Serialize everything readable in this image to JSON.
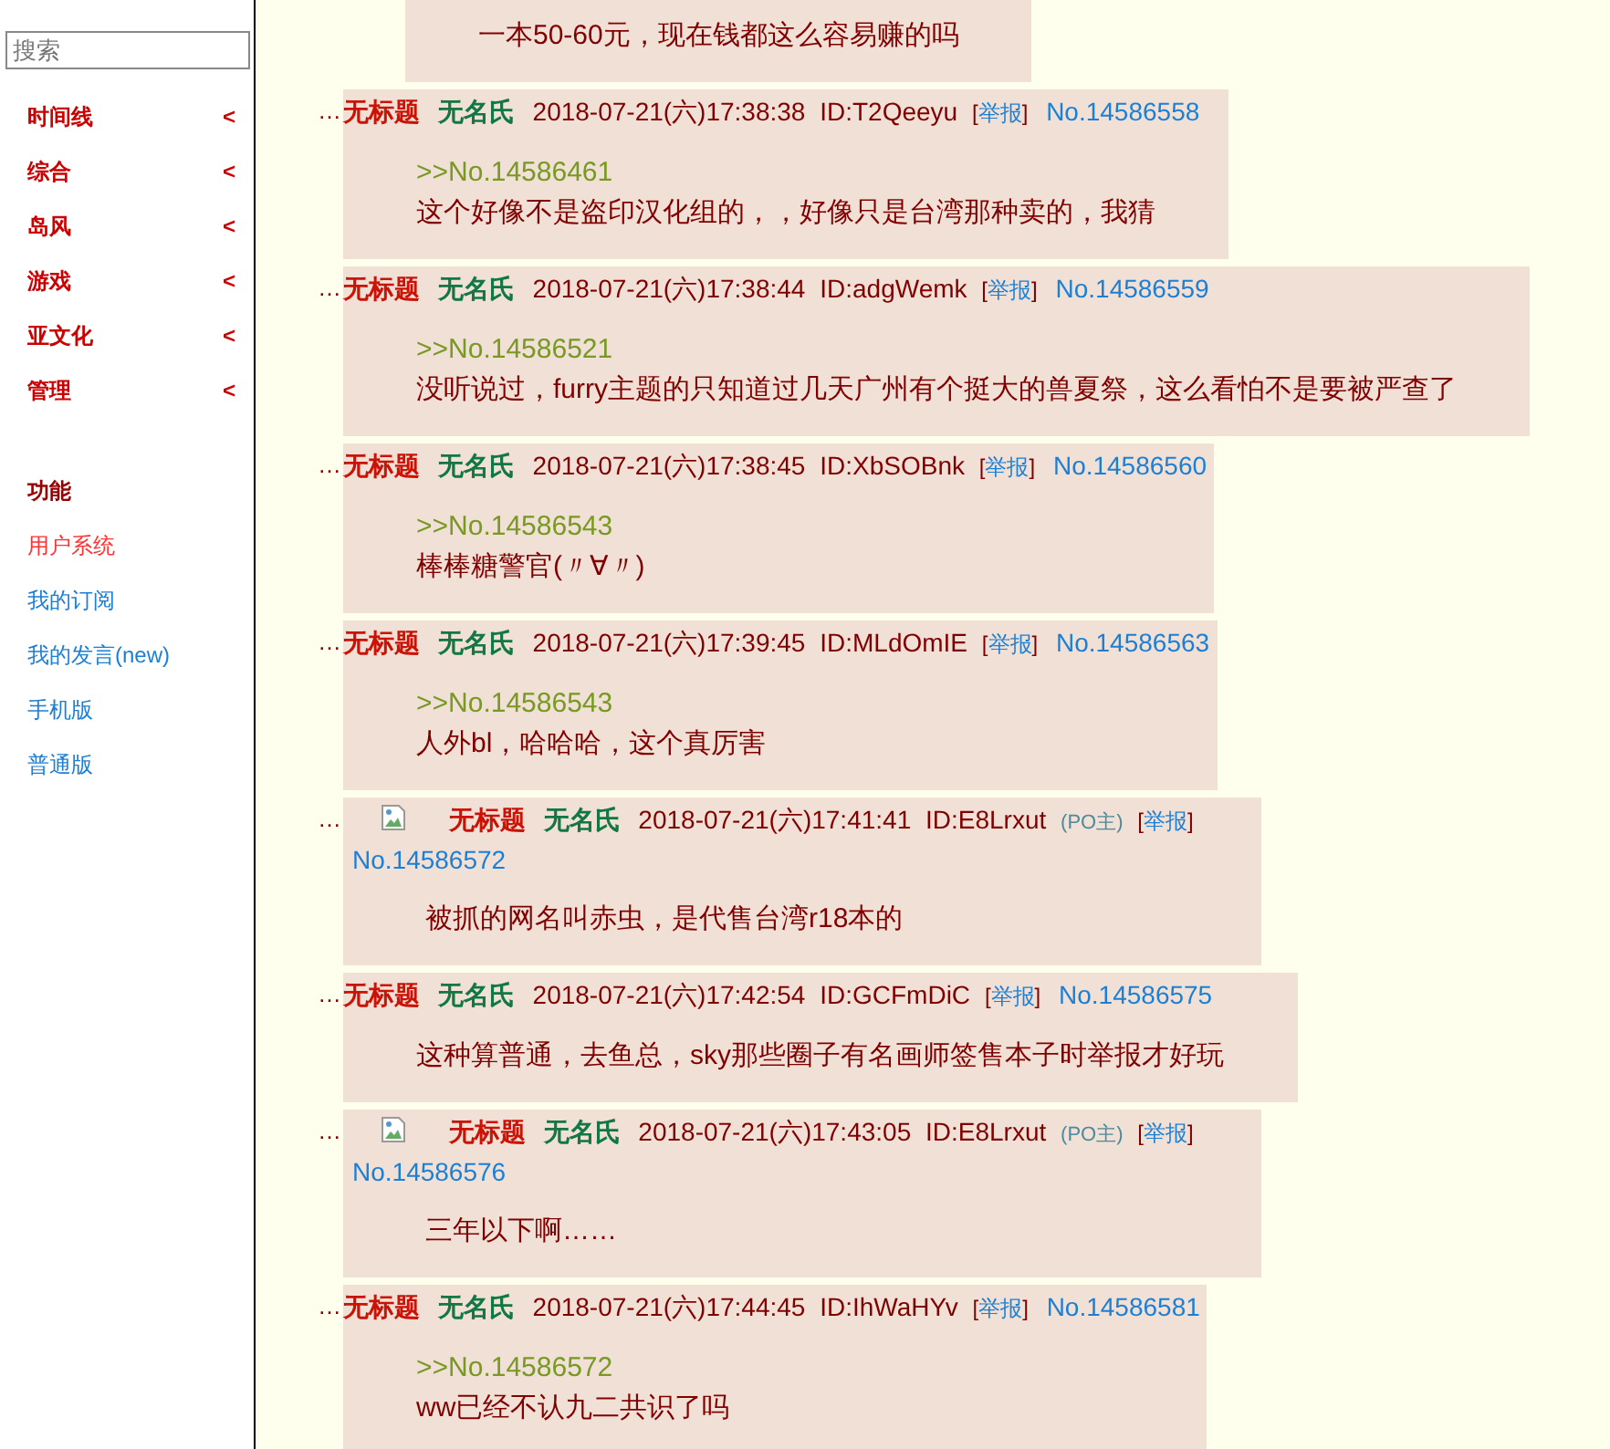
{
  "sidebar": {
    "search": {
      "placeholder": "搜索"
    },
    "nav": [
      {
        "label": "时间线",
        "chevron": "<"
      },
      {
        "label": "综合",
        "chevron": "<"
      },
      {
        "label": "岛风",
        "chevron": "<"
      },
      {
        "label": "游戏",
        "chevron": "<"
      },
      {
        "label": "亚文化",
        "chevron": "<"
      },
      {
        "label": "管理",
        "chevron": "<"
      }
    ],
    "section_title": "功能",
    "links": [
      {
        "label": "用户系统",
        "kind": "highlight"
      },
      {
        "label": "我的订阅",
        "kind": "normal"
      },
      {
        "label": "我的发言(new)",
        "kind": "normal"
      },
      {
        "label": "手机版",
        "kind": "normal"
      },
      {
        "label": "普通版",
        "kind": "normal"
      }
    ]
  },
  "posts": [
    {
      "kind": "fragment",
      "body": "一本50-60元，现在钱都这么容易赚的吗"
    },
    {
      "kind": "text",
      "marker": "…",
      "title": "无标题",
      "name": "无名氏",
      "time": "2018-07-21(六)17:38:38",
      "id": "ID:T2Qeeyu",
      "report": "[举报]",
      "no": "No.14586558",
      "quote": ">>No.14586461",
      "body": "这个好像不是盗印汉化组的，，好像只是台湾那种卖的，我猜"
    },
    {
      "kind": "text",
      "marker": "…",
      "title": "无标题",
      "name": "无名氏",
      "time": "2018-07-21(六)17:38:44",
      "id": "ID:adgWemk",
      "report": "[举报]",
      "no": "No.14586559",
      "quote": ">>No.14586521",
      "body": "没听说过，furry主题的只知道过几天广州有个挺大的兽夏祭，这么看怕不是要被严查了"
    },
    {
      "kind": "text",
      "marker": "…",
      "title": "无标题",
      "name": "无名氏",
      "time": "2018-07-21(六)17:38:45",
      "id": "ID:XbSOBnk",
      "report": "[举报]",
      "no": "No.14586560",
      "quote": ">>No.14586543",
      "body": "棒棒糖警官(〃∀〃)"
    },
    {
      "kind": "text",
      "marker": "…",
      "title": "无标题",
      "name": "无名氏",
      "time": "2018-07-21(六)17:39:45",
      "id": "ID:MLdOmIE",
      "report": "[举报]",
      "no": "No.14586563",
      "quote": ">>No.14586543",
      "body": "人外bl，哈哈哈，这个真厉害"
    },
    {
      "kind": "image",
      "marker": "…",
      "title": "无标题",
      "name": "无名氏",
      "time": "2018-07-21(六)17:41:41",
      "id": "ID:E8Lrxut",
      "po": "(PO主)",
      "report": "[举报]",
      "no": "No.14586572",
      "body": "被抓的网名叫赤虫，是代售台湾r18本的"
    },
    {
      "kind": "text",
      "marker": "…",
      "title": "无标题",
      "name": "无名氏",
      "time": "2018-07-21(六)17:42:54",
      "id": "ID:GCFmDiC",
      "report": "[举报]",
      "no": "No.14586575",
      "body": "这种算普通，去鱼总，sky那些圈子有名画师签售本子时举报才好玩"
    },
    {
      "kind": "image",
      "marker": "…",
      "title": "无标题",
      "name": "无名氏",
      "time": "2018-07-21(六)17:43:05",
      "id": "ID:E8Lrxut",
      "po": "(PO主)",
      "report": "[举报]",
      "no": "No.14586576",
      "body": "三年以下啊……"
    },
    {
      "kind": "text",
      "marker": "…",
      "title": "无标题",
      "name": "无名氏",
      "time": "2018-07-21(六)17:44:45",
      "id": "ID:IhWaHYv",
      "report": "[举报]",
      "no": "No.14586581",
      "quote": ">>No.14586572",
      "body": "ww已经不认九二共识了吗"
    }
  ]
}
